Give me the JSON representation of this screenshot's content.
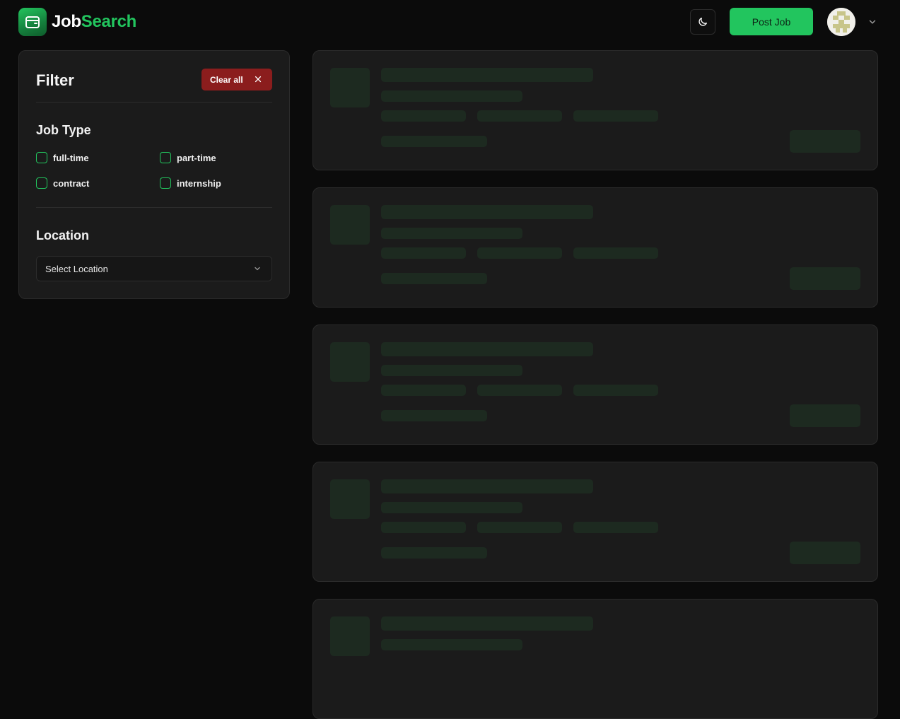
{
  "header": {
    "brand_part1": "Job",
    "brand_part2": "Search",
    "post_job_label": "Post Job",
    "theme_icon": "moon-icon"
  },
  "filter": {
    "title": "Filter",
    "clear_label": "Clear all",
    "job_type_title": "Job Type",
    "job_types": [
      {
        "label": "full-time",
        "checked": false
      },
      {
        "label": "part-time",
        "checked": false
      },
      {
        "label": "contract",
        "checked": false
      },
      {
        "label": "internship",
        "checked": false
      }
    ],
    "location_title": "Location",
    "location_select": "Select Location"
  },
  "colors": {
    "accent": "#22c55e",
    "danger": "#8b1d1d",
    "background": "#0b0b0b",
    "card": "#1b1b1b",
    "skeleton": "#1d2a20"
  },
  "job_cards": [
    {
      "loading": true
    },
    {
      "loading": true
    },
    {
      "loading": true
    },
    {
      "loading": true
    },
    {
      "loading": true
    }
  ]
}
